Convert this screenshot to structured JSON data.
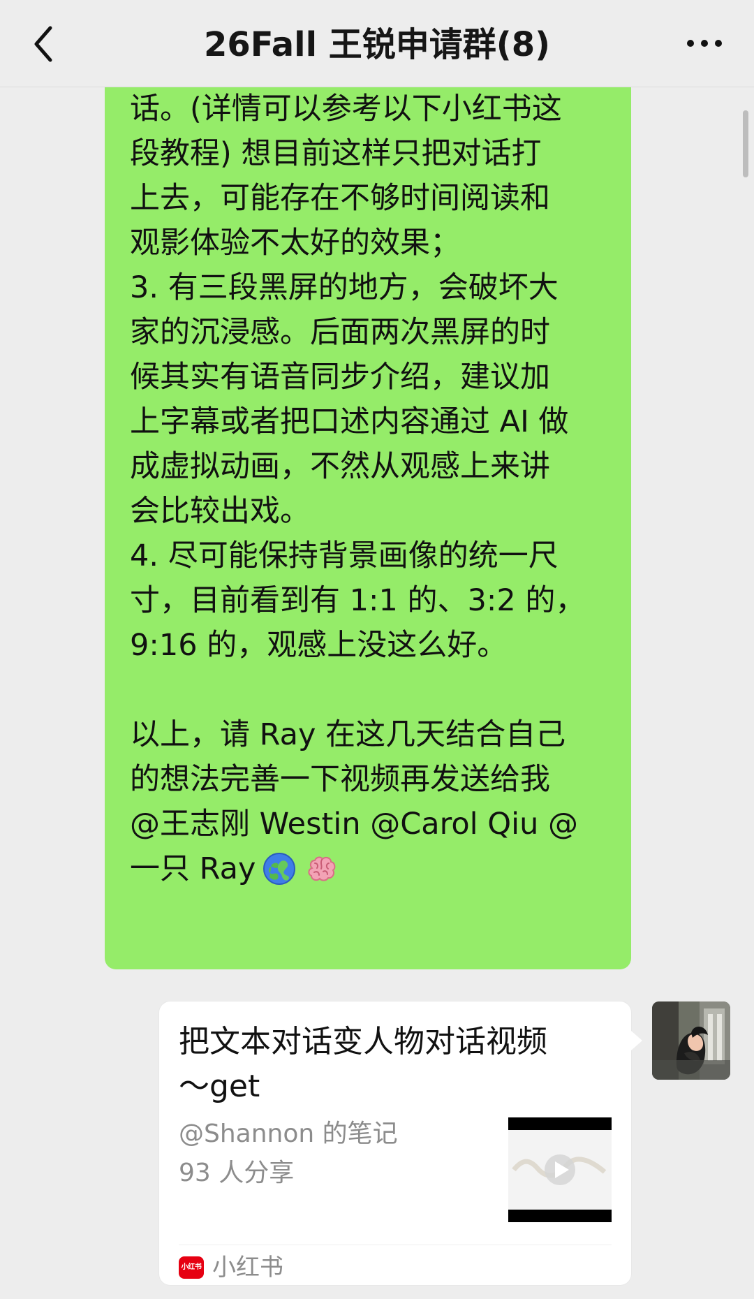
{
  "header": {
    "title": "26Fall 王锐申请群(8)"
  },
  "messages": {
    "green": {
      "text": "者 AI 虚拟访谈对象，然后建立对\n话。(详情可以参考以下小红书这\n段教程) 想目前这样只把对话打\n上去，可能存在不够时间阅读和\n观影体验不太好的效果；\n3. 有三段黑屏的地方，会破坏大\n家的沉浸感。后面两次黑屏的时\n候其实有语音同步介绍，建议加\n上字幕或者把口述内容通过 AI 做\n成虚拟动画，不然从观感上来讲\n会比较出戏。\n4. 尽可能保持背景画像的统一尺\n寸，目前看到有 1:1 的、3:2 的，\n9:16 的，观感上没这么好。\n\n以上，请 Ray 在这几天结合自己\n的想法完善一下视频再发送给我\n@王志刚 Westin @Carol Qiu @",
      "mention_tail": "一只 Ray",
      "emojis": [
        "globe-icon",
        "brain-icon"
      ]
    },
    "share_card": {
      "title": "把文本对话变人物对话视频\n～get",
      "author": "@Shannon 的笔记",
      "share_count": "93 人分享",
      "source": "小红书",
      "logo_text": "小红书",
      "thumbnail_icon": "video-play-icon"
    }
  },
  "colors": {
    "background": "#ededed",
    "green_bubble": "#95ec69",
    "card": "#ffffff",
    "muted_text": "#8c8c8c",
    "xhs_red": "#e60012"
  },
  "icons": {
    "back": "chevron-left-icon",
    "more": "more-icon",
    "avatar": "avatar-photo"
  }
}
